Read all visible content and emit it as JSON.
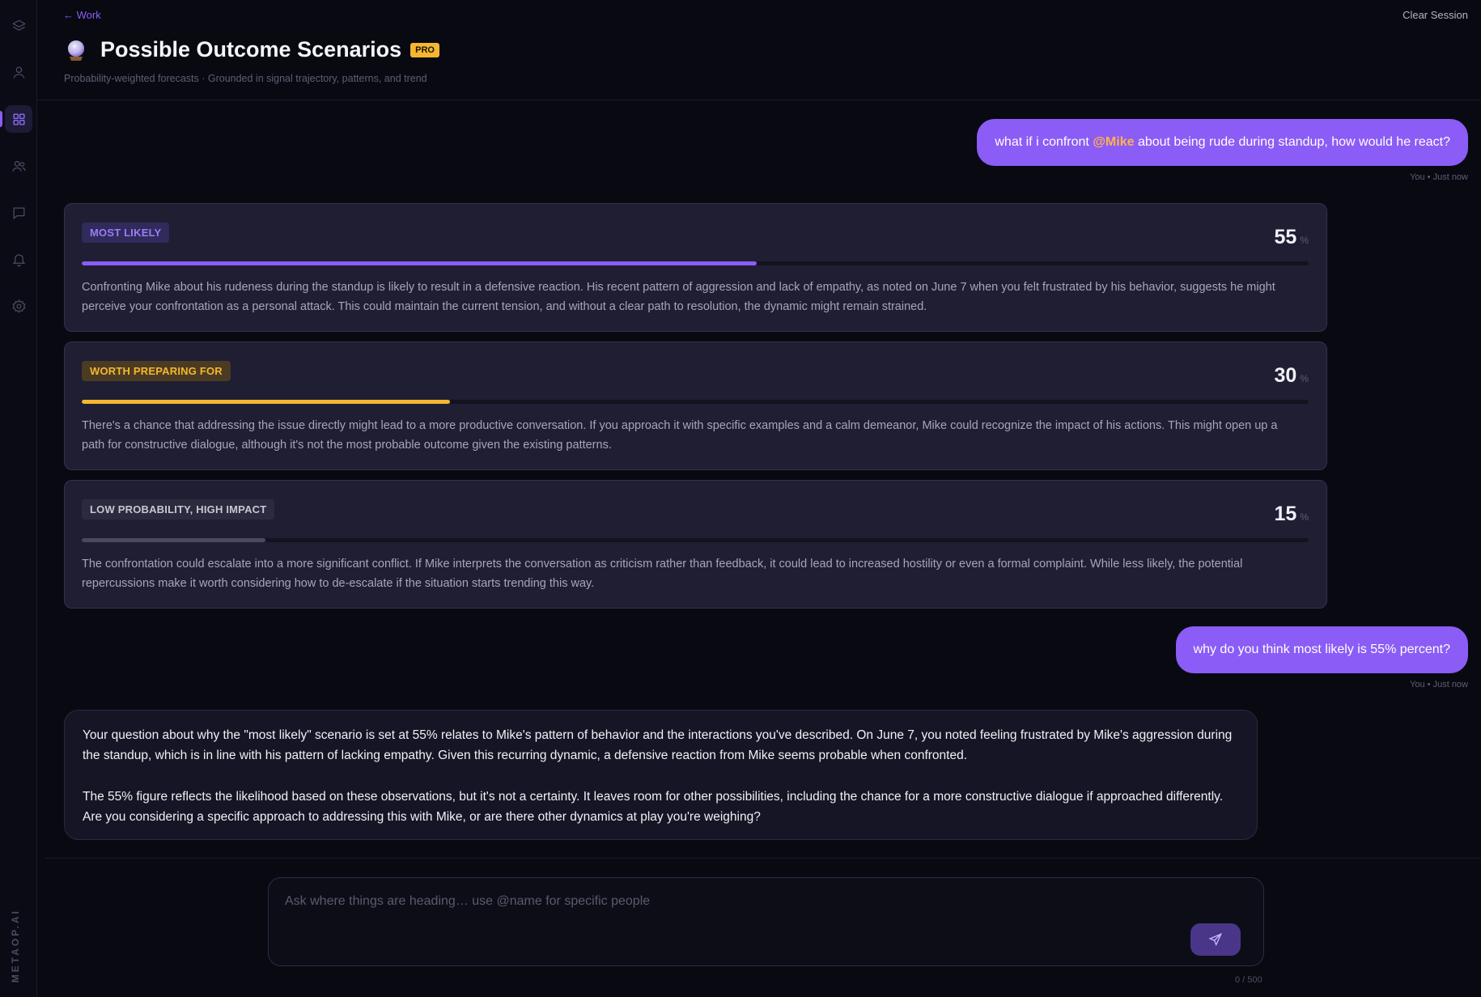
{
  "header": {
    "back_link": "← Work",
    "clear_session": "Clear Session",
    "title": "Possible Outcome Scenarios",
    "badge": "PRO",
    "subtitle": "Probability-weighted forecasts · Grounded in signal trajectory, patterns, and trend"
  },
  "sidebar": {
    "brand": "METAOP.AI",
    "items": [
      {
        "icon": "layers-icon"
      },
      {
        "icon": "user-icon"
      },
      {
        "icon": "grid-icon",
        "active": true
      },
      {
        "icon": "users-icon"
      },
      {
        "icon": "chat-icon"
      },
      {
        "icon": "bell-icon"
      },
      {
        "icon": "gear-icon"
      }
    ]
  },
  "messages": [
    {
      "user": {
        "before": "what if i confront ",
        "mention": "@Mike",
        "after": " about being rude during standup, how would he react?"
      },
      "meta": "You • Just now"
    },
    {
      "user_text": "why do you think most likely is 55% percent?",
      "meta": "You • Just now"
    }
  ],
  "scenarios": [
    {
      "tag": "MOST LIKELY",
      "percent": "55",
      "unit": "%",
      "fraction": 0.55,
      "color": "#8b5cf6",
      "text": "Confronting Mike about his rudeness during the standup is likely to result in a defensive reaction. His recent pattern of aggression and lack of empathy, as noted on June 7 when you felt frustrated by his behavior, suggests he might perceive your confrontation as a personal attack. This could maintain the current tension, and without a clear path to resolution, the dynamic might remain strained."
    },
    {
      "tag": "WORTH PREPARING FOR",
      "percent": "30",
      "unit": "%",
      "fraction": 0.3,
      "color": "#f5b731",
      "text": "There's a chance that addressing the issue directly might lead to a more productive conversation. If you approach it with specific examples and a calm demeanor, Mike could recognize the impact of his actions. This might open up a path for constructive dialogue, although it's not the most probable outcome given the existing patterns."
    },
    {
      "tag": "LOW PROBABILITY, HIGH IMPACT",
      "percent": "15",
      "unit": "%",
      "fraction": 0.15,
      "color": "#4a4a5e",
      "text": "The confrontation could escalate into a more significant conflict. If Mike interprets the conversation as criticism rather than feedback, it could lead to increased hostility or even a formal complaint. While less likely, the potential repercussions make it worth considering how to de-escalate if the situation starts trending this way."
    }
  ],
  "assistant_reply": {
    "p1": "Your question about why the \"most likely\" scenario is set at 55% relates to Mike's pattern of behavior and the interactions you've described. On June 7, you noted feeling frustrated by Mike's aggression during the standup, which is in line with his pattern of lacking empathy. Given this recurring dynamic, a defensive reaction from Mike seems probable when confronted.",
    "p2": "The 55% figure reflects the likelihood based on these observations, but it's not a certainty. It leaves room for other possibilities, including the chance for a more constructive dialogue if approached differently. Are you considering a specific approach to addressing this with Mike, or are there other dynamics at play you're weighing?"
  },
  "composer": {
    "placeholder": "Ask where things are heading… use @name for specific people",
    "value": "",
    "counter": "0 / 500",
    "send_icon": "send-icon"
  }
}
